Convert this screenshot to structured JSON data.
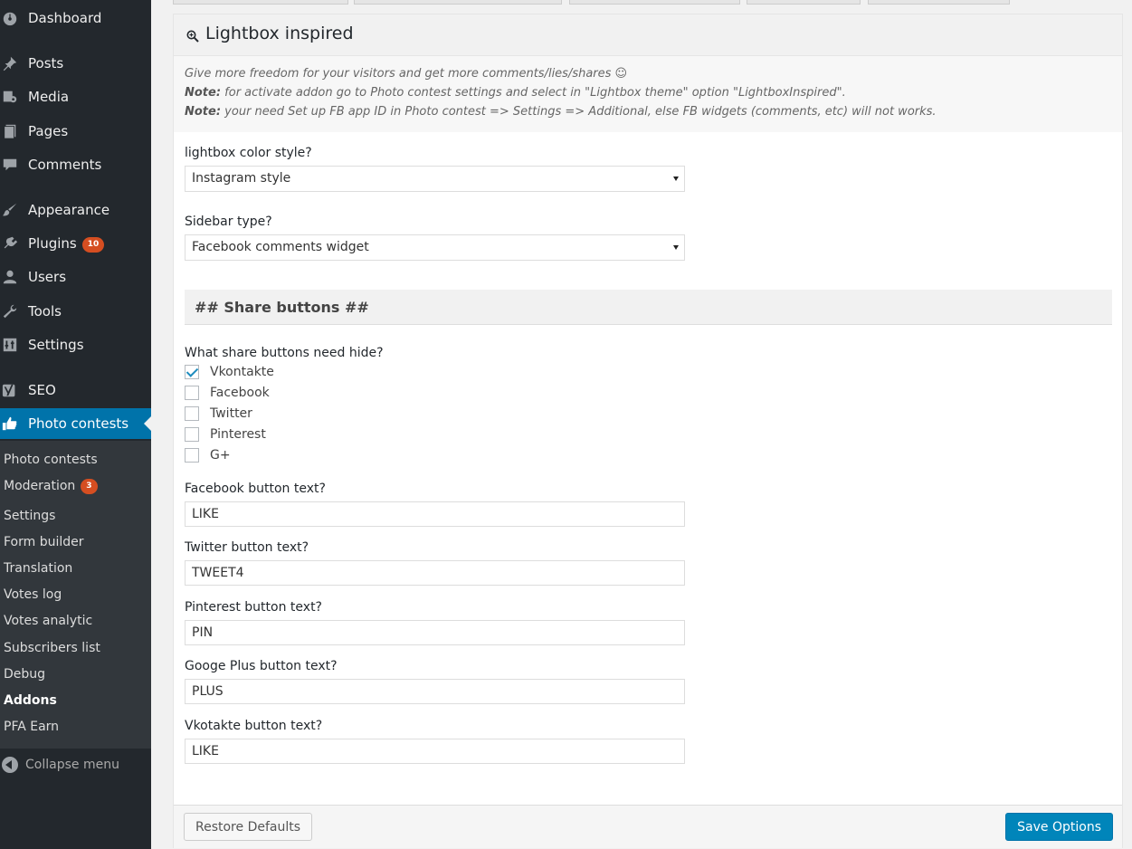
{
  "sidebar": {
    "menu": [
      {
        "label": "Dashboard",
        "icon": "dashboard-icon"
      },
      {
        "label": "Posts",
        "icon": "pushpin-icon"
      },
      {
        "label": "Media",
        "icon": "media-icon"
      },
      {
        "label": "Pages",
        "icon": "pages-icon"
      },
      {
        "label": "Comments",
        "icon": "comment-icon"
      },
      {
        "label": "Appearance",
        "icon": "paintbrush-icon"
      },
      {
        "label": "Plugins",
        "icon": "plugin-icon",
        "badge": "10"
      },
      {
        "label": "Users",
        "icon": "user-icon"
      },
      {
        "label": "Tools",
        "icon": "wrench-icon"
      },
      {
        "label": "Settings",
        "icon": "settings-icon"
      },
      {
        "label": "SEO",
        "icon": "yoast-icon"
      },
      {
        "label": "Photo contests",
        "icon": "thumbs-up-icon"
      }
    ],
    "submenu": [
      {
        "label": "Photo contests"
      },
      {
        "label": "Moderation",
        "badge": "3"
      },
      {
        "label": "Settings"
      },
      {
        "label": "Form builder"
      },
      {
        "label": "Translation"
      },
      {
        "label": "Votes log"
      },
      {
        "label": "Votes analytic"
      },
      {
        "label": "Subscribers list"
      },
      {
        "label": "Debug"
      },
      {
        "label": "Addons"
      },
      {
        "label": "PFA Earn"
      }
    ],
    "collapse_label": "Collapse menu"
  },
  "panel": {
    "title": "Lightbox inspired",
    "description": {
      "line1": "Give more freedom for your visitors and get more comments/lies/shares ☺",
      "note_label": "Note:",
      "line2": " for activate addon go to Photo contest settings and select in \"Lightbox theme\" option \"LightboxInspired\".",
      "line3": " your need Set up FB app ID in Photo contest => Settings => Additional, else FB widgets (comments, etc) will not works."
    },
    "color_style": {
      "label": "lightbox color style?",
      "value": "Instagram style"
    },
    "sidebar_type": {
      "label": "Sidebar type?",
      "value": "Facebook comments widget"
    },
    "share_section_title": "## Share buttons ##",
    "hide_label": "What share buttons need hide?",
    "hide_options": [
      {
        "label": "Vkontakte",
        "checked": true
      },
      {
        "label": "Facebook",
        "checked": false
      },
      {
        "label": "Twitter",
        "checked": false
      },
      {
        "label": "Pinterest",
        "checked": false
      },
      {
        "label": "G+",
        "checked": false
      }
    ],
    "fields": [
      {
        "label": "Facebook button text?",
        "value": "LIKE"
      },
      {
        "label": "Twitter button text?",
        "value": "TWEET4"
      },
      {
        "label": "Pinterest button text?",
        "value": "PIN"
      },
      {
        "label": "Googe Plus button text?",
        "value": "PLUS"
      },
      {
        "label": "Vkotakte button text?",
        "value": "LIKE"
      }
    ],
    "restore_label": "Restore Defaults",
    "save_label": "Save Options"
  },
  "colors": {
    "accent": "#0073aa",
    "badge": "#d54e21",
    "sidebar_bg": "#23282d",
    "primary_button": "#0085ba"
  }
}
